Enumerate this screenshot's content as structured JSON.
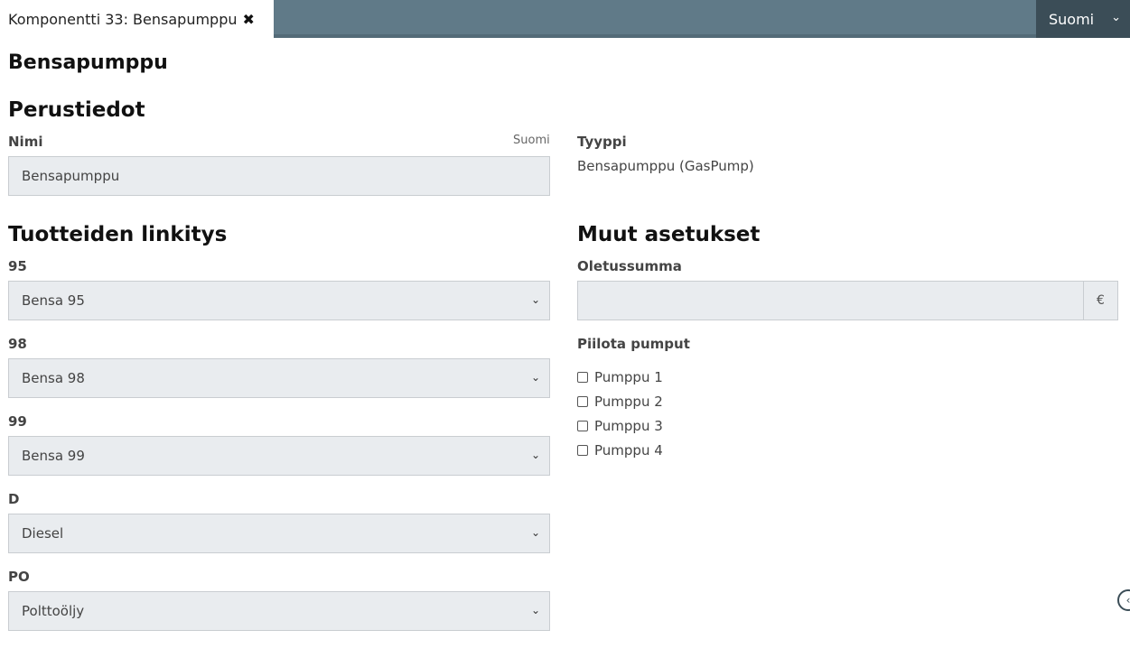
{
  "tab": {
    "title": "Komponentti 33: Bensapumppu",
    "close_icon": "close-icon"
  },
  "language_button": {
    "label": "Suomi"
  },
  "page_title": "Bensapumppu",
  "basic_info": {
    "heading": "Perustiedot",
    "name_label": "Nimi",
    "name_lang_hint": "Suomi",
    "name_value": "Bensapumppu",
    "type_label": "Tyyppi",
    "type_value": "Bensapumppu (GasPump)"
  },
  "product_linking": {
    "heading": "Tuotteiden linkitys",
    "fields": [
      {
        "label": "95",
        "value": "Bensa 95"
      },
      {
        "label": "98",
        "value": "Bensa 98"
      },
      {
        "label": "99",
        "value": "Bensa 99"
      },
      {
        "label": "D",
        "value": "Diesel"
      },
      {
        "label": "PO",
        "value": "Polttoöljy"
      }
    ]
  },
  "other_settings": {
    "heading": "Muut asetukset",
    "default_sum_label": "Oletussumma",
    "default_sum_value": "",
    "currency": "€",
    "hide_pumps_label": "Piilota pumput",
    "pumps": [
      {
        "label": "Pumppu 1",
        "checked": false
      },
      {
        "label": "Pumppu 2",
        "checked": false
      },
      {
        "label": "Pumppu 3",
        "checked": false
      },
      {
        "label": "Pumppu 4",
        "checked": false
      }
    ]
  },
  "colors": {
    "topbar": "#607a88",
    "lang_button": "#3b4d57",
    "field_bg": "#e9ecef"
  }
}
